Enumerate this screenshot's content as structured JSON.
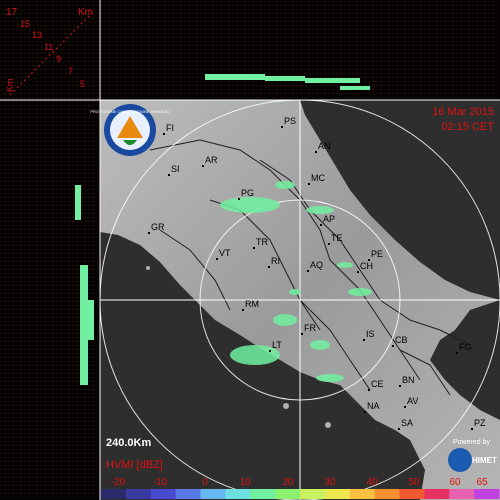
{
  "header": {
    "date": "16 Mar 2015",
    "time": "02:15 CET"
  },
  "height_profile": {
    "unit": "Km",
    "top_left_label": "17",
    "left_axis_label": "Km",
    "levels": [
      "15",
      "13",
      "11",
      "9",
      "7",
      "5"
    ]
  },
  "radar": {
    "range_label": "240.0Km",
    "product_label": "HVMI [dBZ]",
    "colorbar_ticks": [
      "-20",
      "-10",
      "0",
      "10",
      "20",
      "30",
      "40",
      "50",
      "60",
      "65"
    ],
    "colorbar_colors": [
      "#2a2a6a",
      "#3a3aa0",
      "#4a4ad0",
      "#5a7ae8",
      "#66b8f0",
      "#6ee0e0",
      "#70f0a0",
      "#8cf070",
      "#c8f060",
      "#f0e850",
      "#f8c040",
      "#f89030",
      "#f05a30",
      "#e83060",
      "#e860b0",
      "#c040e0"
    ]
  },
  "cities": [
    {
      "code": "PS"
    },
    {
      "code": "FI"
    },
    {
      "code": "AN"
    },
    {
      "code": "AR"
    },
    {
      "code": "SI"
    },
    {
      "code": "MC"
    },
    {
      "code": "PG"
    },
    {
      "code": "GR"
    },
    {
      "code": "AP"
    },
    {
      "code": "TE"
    },
    {
      "code": "TR"
    },
    {
      "code": "VT"
    },
    {
      "code": "RI"
    },
    {
      "code": "PE"
    },
    {
      "code": "AQ"
    },
    {
      "code": "CH"
    },
    {
      "code": "RM"
    },
    {
      "code": "FR"
    },
    {
      "code": "IS"
    },
    {
      "code": "CB"
    },
    {
      "code": "FG"
    },
    {
      "code": "LT"
    },
    {
      "code": "CE"
    },
    {
      "code": "BN"
    },
    {
      "code": "NA"
    },
    {
      "code": "AV"
    },
    {
      "code": "SA"
    },
    {
      "code": "PZ"
    }
  ],
  "logos": {
    "left": "PROTEZIONE CIVILE REGIONE ABRUZZO",
    "powered_by": "Powered by",
    "brand": "HIMET"
  },
  "colors": {
    "frame_red": "#e01010",
    "land": "#a8a8a8",
    "sea": "#333333",
    "echo_green": "#70f0a0"
  }
}
